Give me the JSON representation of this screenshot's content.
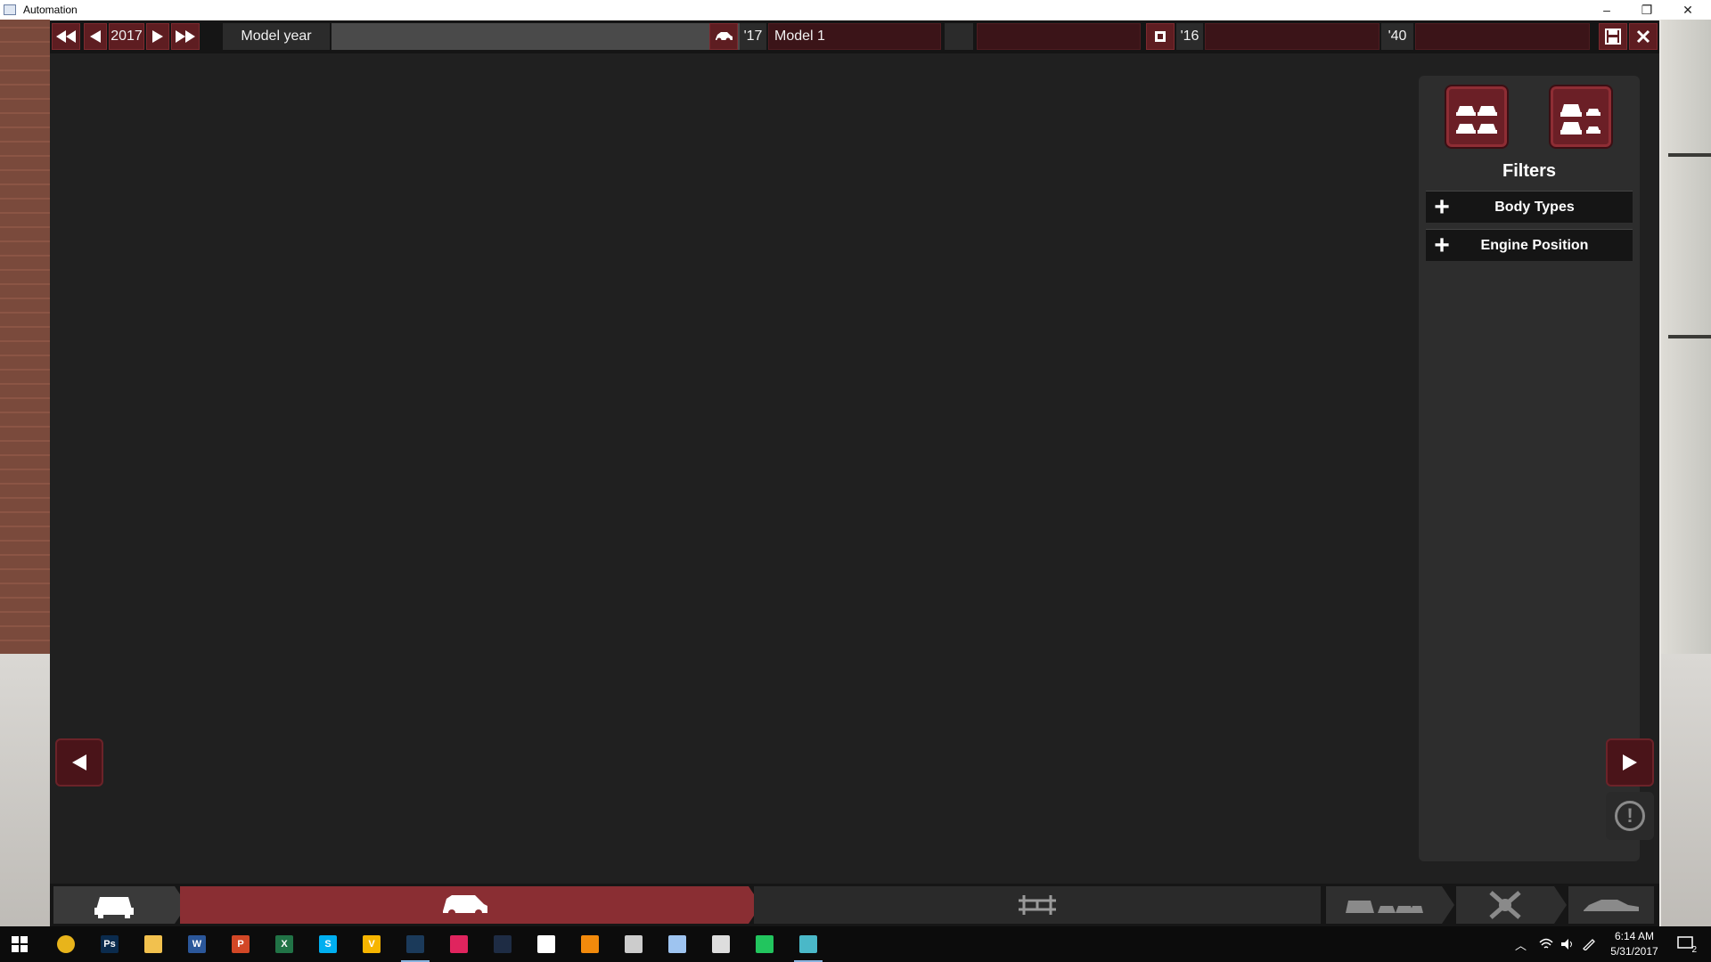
{
  "window": {
    "title": "Automation",
    "minimize": "–",
    "restore": "❐",
    "close": "✕"
  },
  "toolbar": {
    "year": "2017",
    "model_year_label": "Model year",
    "model_year_short": "'17",
    "model_name": "Model 1",
    "engine_year": "'16",
    "engine_extra_year": "'40"
  },
  "filters": {
    "title": "Filters",
    "items": [
      {
        "label": "Body Types"
      },
      {
        "label": "Engine Position"
      }
    ]
  },
  "taskbar": {
    "time": "6:14 AM",
    "date": "5/31/2017",
    "notification_count": "2",
    "apps": [
      {
        "name": "chrome",
        "glyph": "",
        "color": "#e8b41b"
      },
      {
        "name": "photoshop",
        "glyph": "Ps",
        "color": "#0b2b4d"
      },
      {
        "name": "file-explorer",
        "glyph": "",
        "color": "#f2c14e"
      },
      {
        "name": "word",
        "glyph": "W",
        "color": "#2b579a"
      },
      {
        "name": "powerpoint",
        "glyph": "P",
        "color": "#d24726"
      },
      {
        "name": "excel",
        "glyph": "X",
        "color": "#217346"
      },
      {
        "name": "skype",
        "glyph": "S",
        "color": "#00aff0"
      },
      {
        "name": "app-v",
        "glyph": "V",
        "color": "#f7b500"
      },
      {
        "name": "steam",
        "glyph": "",
        "color": "#1b3a5a"
      },
      {
        "name": "app-pink",
        "glyph": "",
        "color": "#e0245e"
      },
      {
        "name": "app-moon",
        "glyph": "",
        "color": "#1e2c44"
      },
      {
        "name": "store",
        "glyph": "",
        "color": "#ffffff"
      },
      {
        "name": "app-orange",
        "glyph": "",
        "color": "#f28a0c"
      },
      {
        "name": "controller",
        "glyph": "",
        "color": "#cccccc"
      },
      {
        "name": "app-diamond",
        "glyph": "",
        "color": "#9ec4f0"
      },
      {
        "name": "app-chart",
        "glyph": "",
        "color": "#dddddd"
      },
      {
        "name": "app-headset",
        "glyph": "",
        "color": "#22c55e"
      },
      {
        "name": "automation",
        "glyph": "",
        "color": "#4ab8c8"
      }
    ]
  },
  "colors": {
    "accent_red": "#6b1f26",
    "panel_dark": "#202020",
    "stage_active": "#8a2e33"
  }
}
